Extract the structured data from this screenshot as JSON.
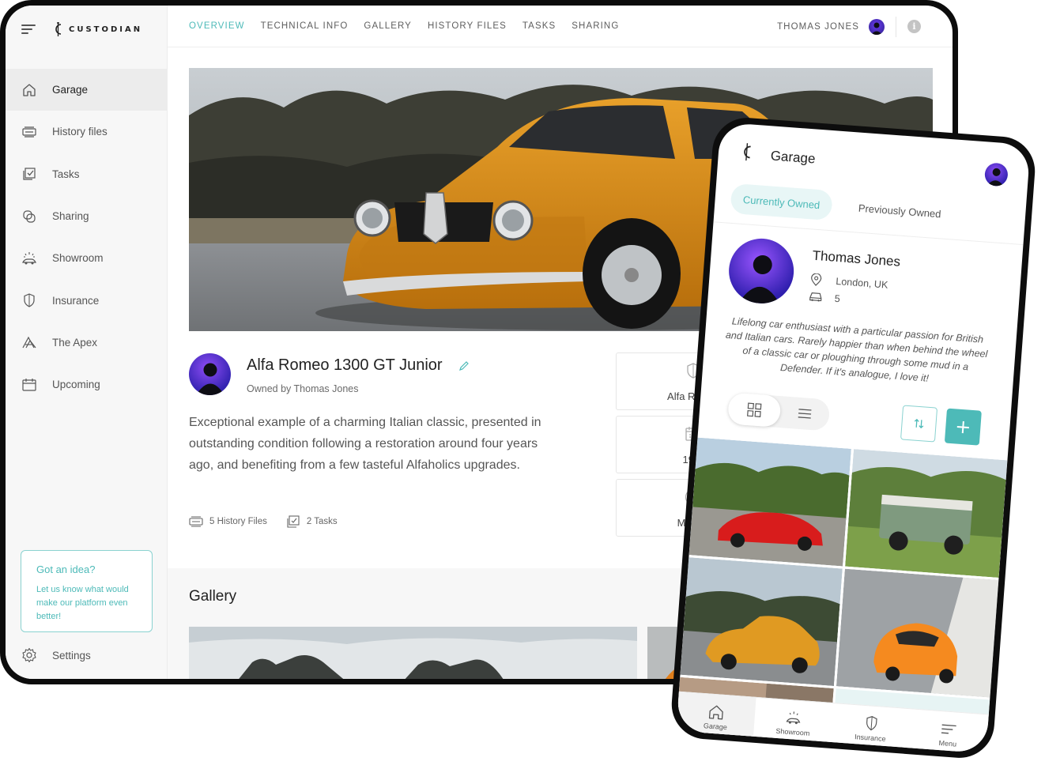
{
  "brand": {
    "logo_text": "CUSTODIAN"
  },
  "colors": {
    "accent": "#4dbab8",
    "avatar": "#5b33d6",
    "car_orange": "#d98a15"
  },
  "sidebar": {
    "items": [
      {
        "label": "Garage",
        "icon": "home-icon",
        "active": true
      },
      {
        "label": "History files",
        "icon": "history-files-icon"
      },
      {
        "label": "Tasks",
        "icon": "tasks-icon"
      },
      {
        "label": "Sharing",
        "icon": "sharing-icon"
      },
      {
        "label": "Showroom",
        "icon": "showroom-icon"
      },
      {
        "label": "Insurance",
        "icon": "shield-icon"
      },
      {
        "label": "The Apex",
        "icon": "apex-icon"
      },
      {
        "label": "Upcoming",
        "icon": "calendar-icon"
      }
    ],
    "idea": {
      "title": "Got an idea?",
      "text": "Let us know what would make our platform even better!"
    },
    "settings": "Settings"
  },
  "topbar": {
    "tabs": [
      "OVERVIEW",
      "TECHNICAL INFO",
      "GALLERY",
      "HISTORY FILES",
      "TASKS",
      "SHARING"
    ],
    "active_tab": "OVERVIEW",
    "user": "THOMAS JONES"
  },
  "car": {
    "title": "Alfa Romeo 1300 GT Junior",
    "owner": "Owned by Thomas Jones",
    "description": "Exceptional example of a charming Italian classic, presented in outstanding condition following a restoration around four years ago, and benefiting from a few tasteful Alfaholics upgrades.",
    "history_files": "5 History Files",
    "tasks": "2 Tasks",
    "specs": [
      {
        "icon": "shield-icon",
        "value": "Alfa Romeo"
      },
      {
        "icon": "calendar-icon",
        "value": "1969"
      },
      {
        "icon": "gearbox-icon",
        "value": "Manual"
      }
    ]
  },
  "gallery": {
    "title": "Gallery"
  },
  "phone": {
    "title": "Garage",
    "tabs": {
      "current": "Currently Owned",
      "previous": "Previously Owned"
    },
    "profile": {
      "name": "Thomas Jones",
      "location": "London, UK",
      "cars": "5",
      "bio": "Lifelong car enthusiast with a particular passion for British and Italian cars. Rarely happier than when behind the wheel of a classic car or ploughing through some mud in a Defender. If it's analogue, I love it!"
    },
    "add_label": "+",
    "bottom_nav": [
      {
        "label": "Garage",
        "icon": "home-icon",
        "active": true
      },
      {
        "label": "Showroom",
        "icon": "showroom-icon"
      },
      {
        "label": "Insurance",
        "icon": "shield-icon"
      },
      {
        "label": "Menu",
        "icon": "menu-icon"
      }
    ]
  }
}
